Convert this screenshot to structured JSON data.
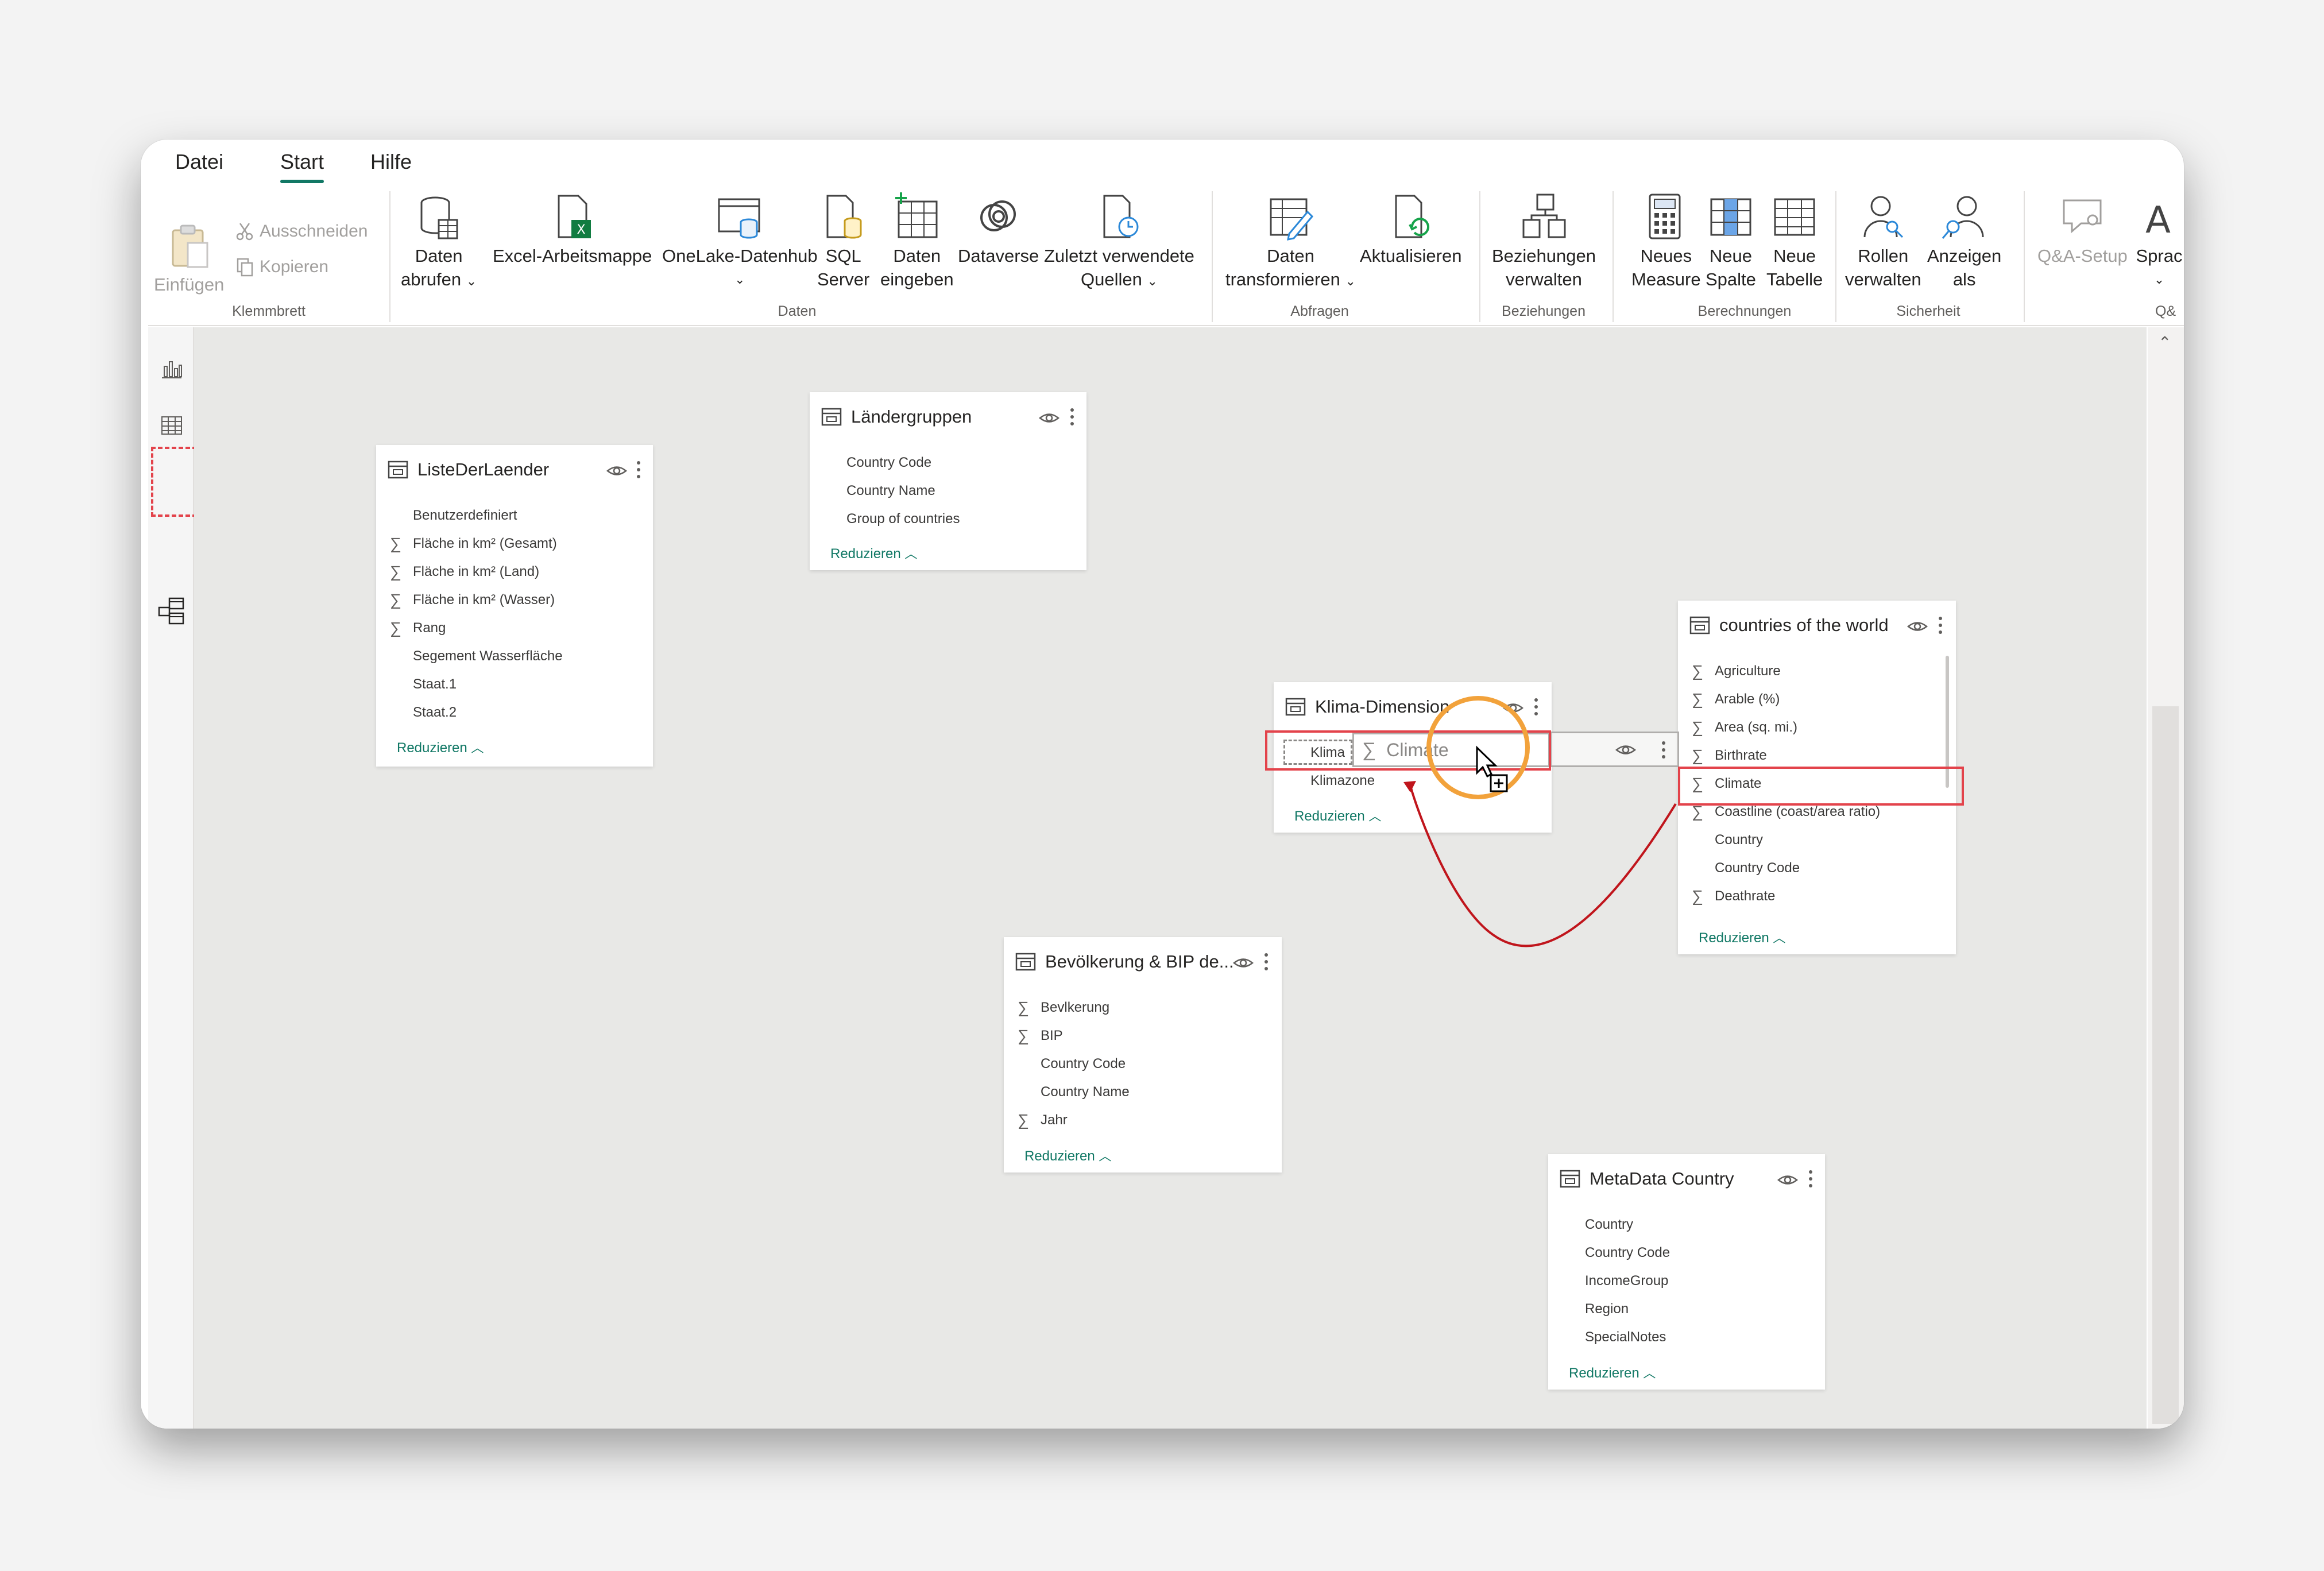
{
  "menu": {
    "tabs": [
      "Datei",
      "Start",
      "Hilfe"
    ],
    "active": "Start"
  },
  "ribbon": {
    "clipboard": {
      "paste": "Einfügen",
      "cut": "Ausschneiden",
      "copy": "Kopieren",
      "group": "Klemmbrett"
    },
    "data": {
      "get_data": [
        "Daten",
        "abrufen"
      ],
      "excel": "Excel-Arbeitsmappe",
      "onelake": "OneLake-Datenhub",
      "sql": [
        "SQL",
        "Server"
      ],
      "enter": [
        "Daten",
        "eingeben"
      ],
      "dataverse": "Dataverse",
      "recent": [
        "Zuletzt verwendete",
        "Quellen"
      ],
      "group": "Daten"
    },
    "queries": {
      "transform": [
        "Daten",
        "transformieren"
      ],
      "refresh": "Aktualisieren",
      "group": "Abfragen"
    },
    "relationships": {
      "manage": [
        "Beziehungen",
        "verwalten"
      ],
      "group": "Beziehungen"
    },
    "calculations": {
      "measure": [
        "Neues",
        "Measure"
      ],
      "column": [
        "Neue",
        "Spalte"
      ],
      "table": [
        "Neue",
        "Tabelle"
      ],
      "group": "Berechnungen"
    },
    "security": {
      "roles": [
        "Rollen",
        "verwalten"
      ],
      "view_as": [
        "Anzeigen",
        "als"
      ],
      "group": "Sicherheit"
    },
    "qa": {
      "setup": "Q&A-Setup",
      "language": "Sprac",
      "group": "Q&"
    }
  },
  "reduce_label": "Reduzieren",
  "tables": {
    "liste": {
      "name": "ListeDerLaender",
      "fields": [
        {
          "label": "Benutzerdefiniert",
          "sigma": false
        },
        {
          "label": "Fläche in km² (Gesamt)",
          "sigma": true
        },
        {
          "label": "Fläche in km² (Land)",
          "sigma": true
        },
        {
          "label": "Fläche in km² (Wasser)",
          "sigma": true
        },
        {
          "label": "Rang",
          "sigma": true
        },
        {
          "label": "Segement Wasserfläche",
          "sigma": false
        },
        {
          "label": "Staat.1",
          "sigma": false
        },
        {
          "label": "Staat.2",
          "sigma": false
        }
      ]
    },
    "laendergruppen": {
      "name": "Ländergruppen",
      "fields": [
        {
          "label": "Country Code",
          "sigma": false
        },
        {
          "label": "Country Name",
          "sigma": false
        },
        {
          "label": "Group of countries",
          "sigma": false
        }
      ]
    },
    "klima": {
      "name": "Klima-Dimension",
      "fields": [
        {
          "label": "Klima",
          "sigma": false
        },
        {
          "label": "Klimazone",
          "sigma": false
        }
      ]
    },
    "countries": {
      "name": "countries of the world",
      "fields": [
        {
          "label": "Agriculture",
          "sigma": true
        },
        {
          "label": "Arable (%)",
          "sigma": true
        },
        {
          "label": "Area (sq. mi.)",
          "sigma": true
        },
        {
          "label": "Birthrate",
          "sigma": true
        },
        {
          "label": "Climate",
          "sigma": true
        },
        {
          "label": "Coastline (coast/area ratio)",
          "sigma": true
        },
        {
          "label": "Country",
          "sigma": false
        },
        {
          "label": "Country Code",
          "sigma": false
        },
        {
          "label": "Deathrate",
          "sigma": true
        }
      ]
    },
    "bevoelkerung": {
      "name": "Bevölkerung & BIP de...",
      "fields": [
        {
          "label": "Bevlkerung",
          "sigma": true
        },
        {
          "label": "BIP",
          "sigma": true
        },
        {
          "label": "Country Code",
          "sigma": false
        },
        {
          "label": "Country Name",
          "sigma": false
        },
        {
          "label": "Jahr",
          "sigma": true
        }
      ]
    },
    "metadata": {
      "name": "MetaData Country",
      "fields": [
        {
          "label": "Country",
          "sigma": false
        },
        {
          "label": "Country Code",
          "sigma": false
        },
        {
          "label": "IncomeGroup",
          "sigma": false
        },
        {
          "label": "Region",
          "sigma": false
        },
        {
          "label": "SpecialNotes",
          "sigma": false
        }
      ]
    }
  },
  "drag": {
    "ghost_label": "Climate"
  },
  "colors": {
    "accent": "#117865",
    "highlight": "#e3434b",
    "ring": "#f2a23b",
    "arrow": "#c0151c"
  }
}
